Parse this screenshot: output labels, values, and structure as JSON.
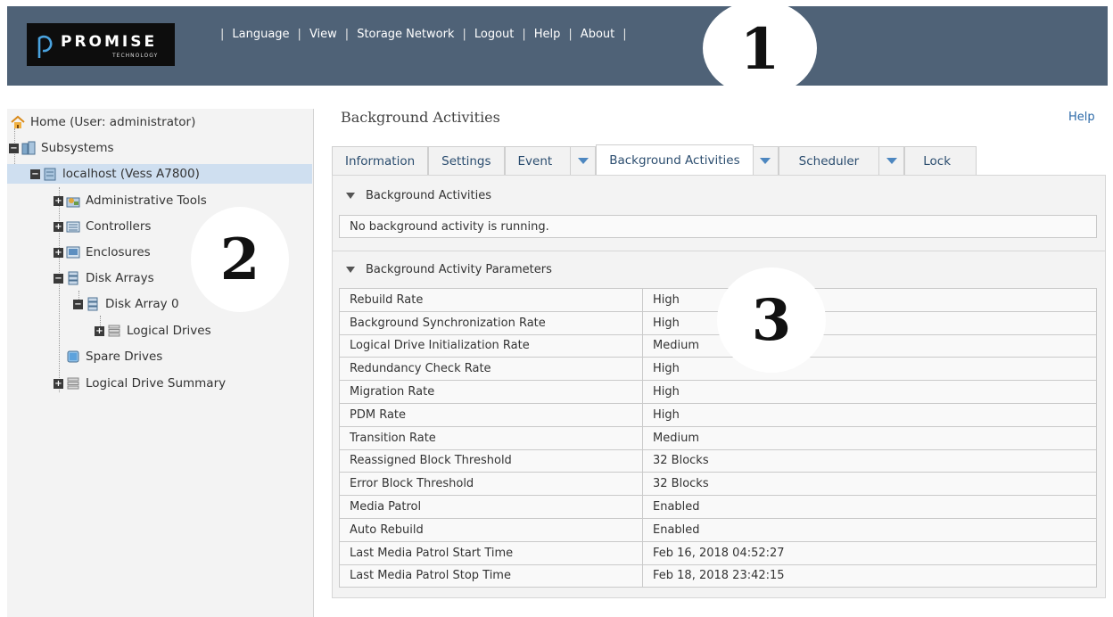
{
  "header": {
    "logo_text": "PROMISE",
    "logo_sub": "TECHNOLOGY",
    "menu": [
      "Language",
      "View",
      "Storage Network",
      "Logout",
      "Help",
      "About"
    ]
  },
  "callouts": [
    "1",
    "2",
    "3"
  ],
  "tree": {
    "home": "Home (User: administrator)",
    "subsystems": "Subsystems",
    "localhost": "localhost (Vess A7800)",
    "admin_tools": "Administrative Tools",
    "controllers": "Controllers",
    "enclosures": "Enclosures",
    "disk_arrays": "Disk Arrays",
    "disk_array_0": "Disk Array 0",
    "logical_drives": "Logical Drives",
    "spare_drives": "Spare Drives",
    "logical_drive_summary": "Logical Drive Summary"
  },
  "main": {
    "title": "Background Activities",
    "help": "Help",
    "tabs": [
      "Information",
      "Settings",
      "Event",
      "Background Activities",
      "Scheduler",
      "Lock"
    ],
    "section1_title": "Background Activities",
    "section1_message": "No background activity is running.",
    "section2_title": "Background Activity Parameters",
    "params": [
      [
        "Rebuild Rate",
        "High"
      ],
      [
        "Background Synchronization Rate",
        "High"
      ],
      [
        "Logical Drive Initialization Rate",
        "Medium"
      ],
      [
        "Redundancy Check Rate",
        "High"
      ],
      [
        "Migration Rate",
        "High"
      ],
      [
        "PDM Rate",
        "High"
      ],
      [
        "Transition Rate",
        "Medium"
      ],
      [
        "Reassigned Block Threshold",
        "32 Blocks"
      ],
      [
        "Error Block Threshold",
        "32 Blocks"
      ],
      [
        "Media Patrol",
        "Enabled"
      ],
      [
        "Auto Rebuild",
        "Enabled"
      ],
      [
        "Last Media Patrol Start Time",
        "Feb 16, 2018 04:52:27"
      ],
      [
        "Last Media Patrol Stop Time",
        "Feb 18, 2018 23:42:15"
      ]
    ]
  },
  "colors": {
    "header_bg": "#4f6277",
    "link_blue": "#2d6aa8",
    "selected_row": "#cfdff0",
    "dropdown_arrow": "#4d87c0"
  }
}
